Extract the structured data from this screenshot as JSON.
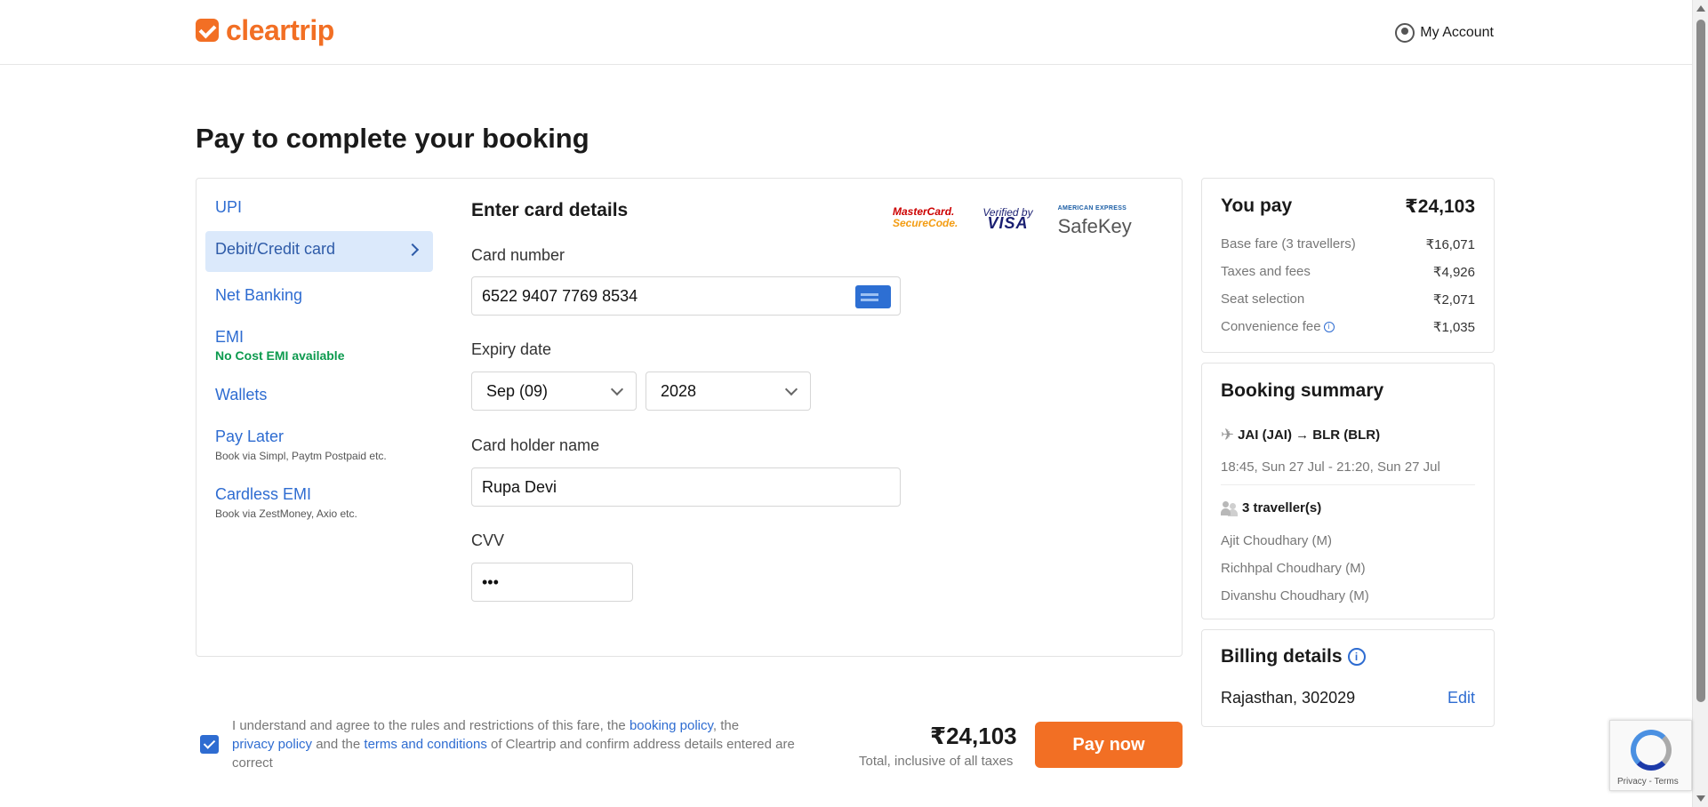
{
  "header": {
    "logo_text": "cleartrip",
    "account_label": "My Account"
  },
  "page_title": "Pay to complete your booking",
  "payment_methods": [
    {
      "label": "UPI",
      "sub": ""
    },
    {
      "label": "Debit/Credit card",
      "sub": ""
    },
    {
      "label": "Net Banking",
      "sub": ""
    },
    {
      "label": "EMI",
      "sub": "No Cost EMI available"
    },
    {
      "label": "Wallets",
      "sub": ""
    },
    {
      "label": "Pay Later",
      "sub": "Book via Simpl, Paytm Postpaid etc."
    },
    {
      "label": "Cardless EMI",
      "sub": "Book via ZestMoney, Axio etc."
    }
  ],
  "card_form": {
    "title": "Enter card details",
    "brands": {
      "mastercard_top": "MasterCard.",
      "mastercard_bottom": "SecureCode.",
      "visa_top": "Verified by",
      "visa_bottom": "VISA",
      "amex_top": "AMERICAN EXPRESS",
      "amex_bottom": "SafeKey"
    },
    "card_number_label": "Card number",
    "card_number_value": "6522 9407 7769 8534",
    "expiry_label": "Expiry date",
    "expiry_month": "Sep (09)",
    "expiry_year": "2028",
    "holder_label": "Card holder name",
    "holder_value": "Rupa Devi",
    "cvv_label": "CVV",
    "cvv_value": "•••"
  },
  "you_pay": {
    "title": "You pay",
    "total": "₹24,103",
    "rows": [
      {
        "label": "Base fare (3 travellers)",
        "value": "₹16,071"
      },
      {
        "label": "Taxes and fees",
        "value": "₹4,926"
      },
      {
        "label": "Seat selection",
        "value": "₹2,071"
      },
      {
        "label": "Convenience fee",
        "value": "₹1,035"
      }
    ]
  },
  "booking_summary": {
    "title": "Booking summary",
    "route": "JAI (JAI) → BLR (BLR)",
    "times": "18:45, Sun 27 Jul - 21:20, Sun 27 Jul",
    "travellers_head": "3 traveller(s)",
    "travellers": [
      "Ajit Choudhary (M)",
      "Richhpal Choudhary (M)",
      "Divanshu Choudhary (M)"
    ]
  },
  "billing": {
    "title": "Billing details",
    "address": "Rajasthan, 302029",
    "edit_label": "Edit"
  },
  "footer": {
    "agree_1": "I understand and agree to the rules and restrictions of this fare, the ",
    "booking_policy": "booking policy",
    "agree_2": ", the ",
    "privacy_policy": "privacy policy",
    "agree_3": " and the ",
    "terms": "terms and conditions",
    "agree_4": " of Cleartrip and confirm address details entered are correct",
    "total": "₹24,103",
    "total_note": "Total, inclusive of all taxes",
    "pay_button": "Pay now"
  },
  "recaptcha": {
    "text": "Privacy - Terms"
  },
  "colors": {
    "brand": "#f26f24",
    "link": "#2e6cd1",
    "active_bg": "#dbe9fb",
    "green": "#0c9a4e"
  }
}
